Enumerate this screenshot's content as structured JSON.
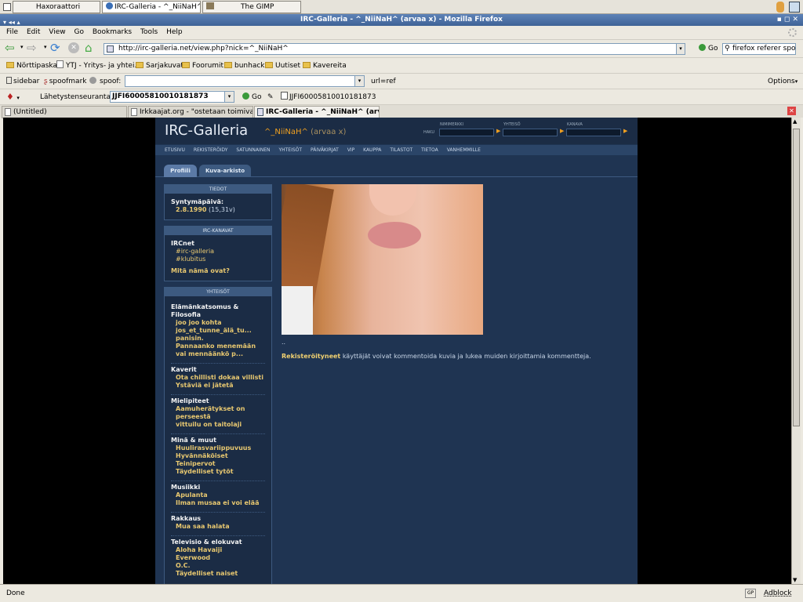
{
  "taskbar": {
    "items": [
      {
        "label": "Haxoraattori"
      },
      {
        "label": "IRC-Galleria - ^_NiiNaH^ (arv"
      },
      {
        "label": "The GIMP"
      }
    ]
  },
  "window": {
    "title": "IRC-Galleria - ^_NiiNaH^ (arvaa x) - Mozilla Firefox"
  },
  "menu": {
    "items": [
      "File",
      "Edit",
      "View",
      "Go",
      "Bookmarks",
      "Tools",
      "Help"
    ]
  },
  "nav": {
    "url": "http://irc-galleria.net/view.php?nick=^_NiiNaH^",
    "go_label": "Go",
    "search_value": "firefox referer spo"
  },
  "bookmarks": {
    "items": [
      "Nörttipaska",
      "YTJ - Yritys- ja yhtei...",
      "Sarjakuvat",
      "Foorumit",
      "bunhack",
      "Uutiset",
      "Kavereita"
    ]
  },
  "toolbar2": {
    "sidebar": "sidebar",
    "spoofmark": "spoofmark",
    "spoof": "spoof:",
    "url_ref": "url=ref",
    "options": "Options"
  },
  "toolbar3": {
    "tracker": "Lähetystenseuranta",
    "field_value": "JJFI60005810010181873",
    "go": "Go",
    "result": "JJFI60005810010181873"
  },
  "tabs": [
    {
      "label": "(Untitled)"
    },
    {
      "label": "Irkkaajat.org - \"ostetaan toimiva ..."
    },
    {
      "label": "IRC-Galleria - ^_NiiNaH^ (arv..."
    }
  ],
  "status": {
    "text": "Done",
    "gp": "GP",
    "adblock": "Adblock"
  },
  "site": {
    "logo": "IRC-Galleria",
    "nick": "^_NiiNaH^",
    "nick_suffix": "(arvaa x)",
    "search_labels": [
      "NIMIMERKKI",
      "YHTEISÖ",
      "KANAVA"
    ],
    "haku": "HAKU",
    "nav": [
      "ETUSIVU",
      "REKISTERÖIDY",
      "SATUNNAINEN",
      "YHTEISÖT",
      "PÄIVÄKIRJAT",
      "VIP",
      "KAUPPA",
      "TILASTOT",
      "TIETOA",
      "VANHEMMILLE"
    ],
    "subtabs": [
      "Profiili",
      "Kuva-arkisto"
    ],
    "tiedot": {
      "title": "TIEDOT",
      "label": "Syntymäpäivä:",
      "date": "2.8.1990",
      "age": "(15,31v)"
    },
    "irc": {
      "title": "IRC-KANAVAT",
      "network": "IRCnet",
      "channels": [
        "#irc-galleria",
        "#klubitus"
      ],
      "what": "Mitä nämä ovat?"
    },
    "yhteisot": {
      "title": "YHTEISÖT",
      "groups": [
        {
          "name": "Elämänkatsomus & Filosofia",
          "items": [
            "joo joo kohta",
            "jos_et_tunne_älä_tu...",
            "panisin.",
            "Pannaanko menemään vai mennäänkö p..."
          ]
        },
        {
          "name": "Kaverit",
          "items": [
            "Ota chillisti dokaa villisti",
            "Ystäviä ei jätetä"
          ]
        },
        {
          "name": "Mielipiteet",
          "items": [
            "Aamuherätykset on perseestä",
            "vittuilu on taitolaji"
          ]
        },
        {
          "name": "Minä & muut",
          "items": [
            "Huulirasvariippuvuus",
            "Hyvännäköiset",
            "Teinipervot",
            "Täydelliset tytöt"
          ]
        },
        {
          "name": "Musiikki",
          "items": [
            "Apulanta",
            "Ilman musaa ei voi elää"
          ]
        },
        {
          "name": "Rakkaus",
          "items": [
            "Mua saa halata"
          ]
        },
        {
          "name": "Televisio & elokuvat",
          "items": [
            "Aloha Havaiji",
            "Everwood",
            "O.C.",
            "Täydelliset naiset"
          ]
        }
      ]
    },
    "photo_caption": "..",
    "reg_bold": "Rekisteröityneet",
    "reg_text": "käyttäjät voivat kommentoida kuvia ja lukea muiden kirjoittamia kommentteja."
  }
}
